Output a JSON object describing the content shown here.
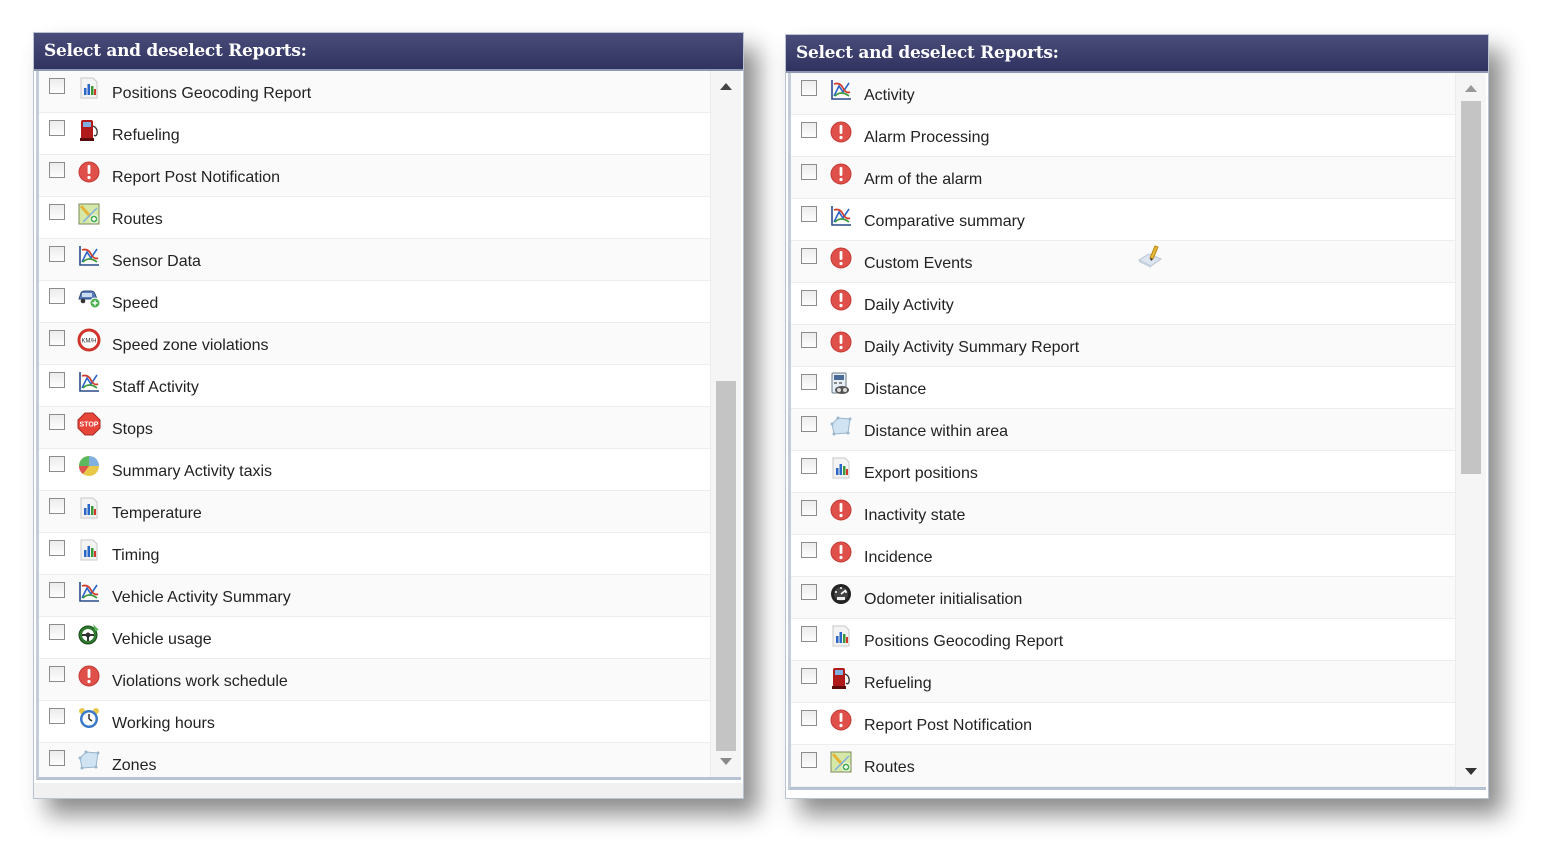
{
  "left_panel": {
    "title": "Select and deselect Reports:",
    "items": [
      {
        "label": "Positions Geocoding Report",
        "icon": "bar-chart-icon",
        "checked": false
      },
      {
        "label": "Refueling",
        "icon": "fuel-pump-icon",
        "checked": false
      },
      {
        "label": "Report Post Notification",
        "icon": "alert-icon",
        "checked": false
      },
      {
        "label": "Routes",
        "icon": "route-map-icon",
        "checked": false
      },
      {
        "label": "Sensor Data",
        "icon": "line-chart-icon",
        "checked": false
      },
      {
        "label": "Speed",
        "icon": "car-icon",
        "checked": false
      },
      {
        "label": "Speed zone violations",
        "icon": "speed-limit-icon",
        "checked": false
      },
      {
        "label": "Staff Activity",
        "icon": "line-chart-icon",
        "checked": false
      },
      {
        "label": "Stops",
        "icon": "stop-sign-icon",
        "checked": false
      },
      {
        "label": "Summary Activity taxis",
        "icon": "pie-chart-icon",
        "checked": false
      },
      {
        "label": "Temperature",
        "icon": "bar-chart-icon",
        "checked": false
      },
      {
        "label": "Timing",
        "icon": "bar-chart-icon",
        "checked": false
      },
      {
        "label": "Vehicle Activity Summary",
        "icon": "line-chart-icon",
        "checked": false
      },
      {
        "label": "Vehicle usage",
        "icon": "steering-wheel-icon",
        "checked": false
      },
      {
        "label": "Violations work schedule",
        "icon": "alert-icon",
        "checked": false
      },
      {
        "label": "Working hours",
        "icon": "alarm-clock-icon",
        "checked": false
      },
      {
        "label": "Zones",
        "icon": "zone-polygon-icon",
        "checked": false
      }
    ]
  },
  "right_panel": {
    "title": "Select and deselect Reports:",
    "items": [
      {
        "label": "Activity",
        "icon": "line-chart-icon",
        "checked": false
      },
      {
        "label": "Alarm Processing",
        "icon": "alert-icon",
        "checked": false
      },
      {
        "label": "Arm of the alarm",
        "icon": "alert-icon",
        "checked": false
      },
      {
        "label": "Comparative summary",
        "icon": "line-chart-icon",
        "checked": false
      },
      {
        "label": "Custom Events",
        "icon": "alert-icon",
        "checked": false,
        "has_edit": true
      },
      {
        "label": "Daily Activity",
        "icon": "alert-icon",
        "checked": false
      },
      {
        "label": "Daily Activity Summary Report",
        "icon": "alert-icon",
        "checked": false
      },
      {
        "label": "Distance",
        "icon": "calculator-icon",
        "checked": false
      },
      {
        "label": "Distance within area",
        "icon": "zone-polygon-icon",
        "checked": false
      },
      {
        "label": "Export positions",
        "icon": "bar-chart-icon",
        "checked": false
      },
      {
        "label": "Inactivity state",
        "icon": "alert-icon",
        "checked": false
      },
      {
        "label": "Incidence",
        "icon": "alert-icon",
        "checked": false
      },
      {
        "label": "Odometer initialisation",
        "icon": "odometer-icon",
        "checked": false
      },
      {
        "label": "Positions Geocoding Report",
        "icon": "bar-chart-icon",
        "checked": false
      },
      {
        "label": "Refueling",
        "icon": "fuel-pump-icon",
        "checked": false
      },
      {
        "label": "Report Post Notification",
        "icon": "alert-icon",
        "checked": false
      },
      {
        "label": "Routes",
        "icon": "route-map-icon",
        "checked": false
      }
    ]
  },
  "colors": {
    "header_bg": "#3a3c6a",
    "alert": "#e0504a",
    "scroll_thumb": "#c4c4c4"
  }
}
